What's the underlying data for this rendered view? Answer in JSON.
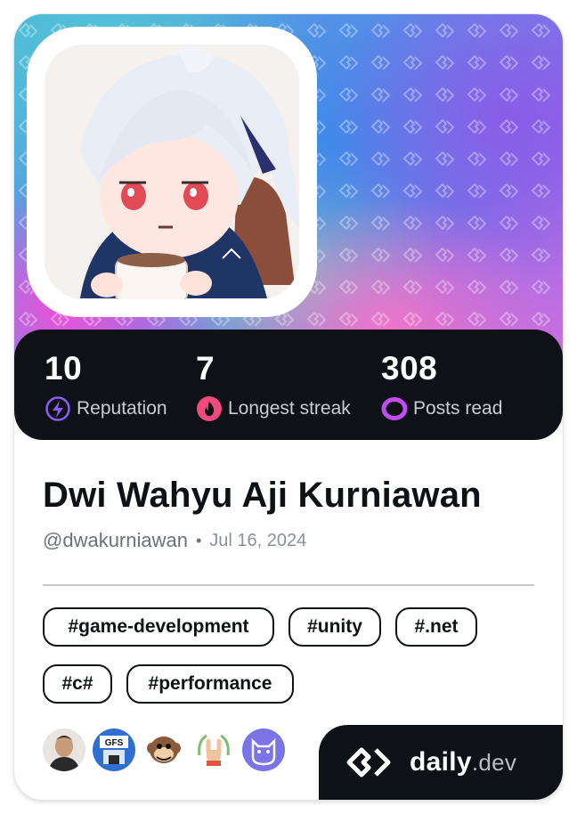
{
  "profile": {
    "name": "Dwi Wahyu Aji Kurniawan",
    "handle": "@dwakurniawan",
    "separator": "•",
    "joined": "Jul 16, 2024"
  },
  "stats": [
    {
      "value": "10",
      "label": "Reputation",
      "icon": "lightning-icon",
      "color": "#8a5cf6"
    },
    {
      "value": "7",
      "label": "Longest streak",
      "icon": "flame-icon",
      "color": "#ef4a7e"
    },
    {
      "value": "308",
      "label": "Posts read",
      "icon": "ring-icon",
      "color": "#c14cf0"
    }
  ],
  "tags": [
    "#game-development",
    "#unity",
    "#.net",
    "#c#",
    "#performance"
  ],
  "badges": [
    "person-avatar",
    "gfs-avatar",
    "monkey-avatar",
    "rock-hand-avatar",
    "cat-avatar"
  ],
  "brand": {
    "name": "daily",
    "tld": ".dev"
  },
  "colors": {
    "dark": "#0e1217",
    "accent_purple": "#8a5cf6",
    "accent_pink": "#ef4a7e"
  }
}
